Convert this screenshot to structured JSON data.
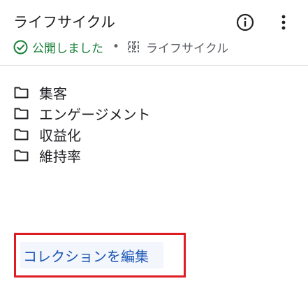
{
  "header": {
    "title": "ライフサイクル",
    "info_icon": "info-circle-icon",
    "more_icon": "more-vert-icon"
  },
  "status": {
    "published_icon": "check-circle-icon",
    "published_label": "公開しました",
    "separator": "•",
    "collection_icon": "collection-icon",
    "collection_name": "ライフサイクル",
    "published_color": "#188038"
  },
  "folders": [
    {
      "icon": "folder-icon",
      "label": "集客"
    },
    {
      "icon": "folder-icon",
      "label": "エンゲージメント"
    },
    {
      "icon": "folder-icon",
      "label": "収益化"
    },
    {
      "icon": "folder-icon",
      "label": "維持率"
    }
  ],
  "footer": {
    "edit_collection_label": "コレクションを編集",
    "accent_color": "#1a56b4",
    "highlight_color": "#e01b24"
  }
}
